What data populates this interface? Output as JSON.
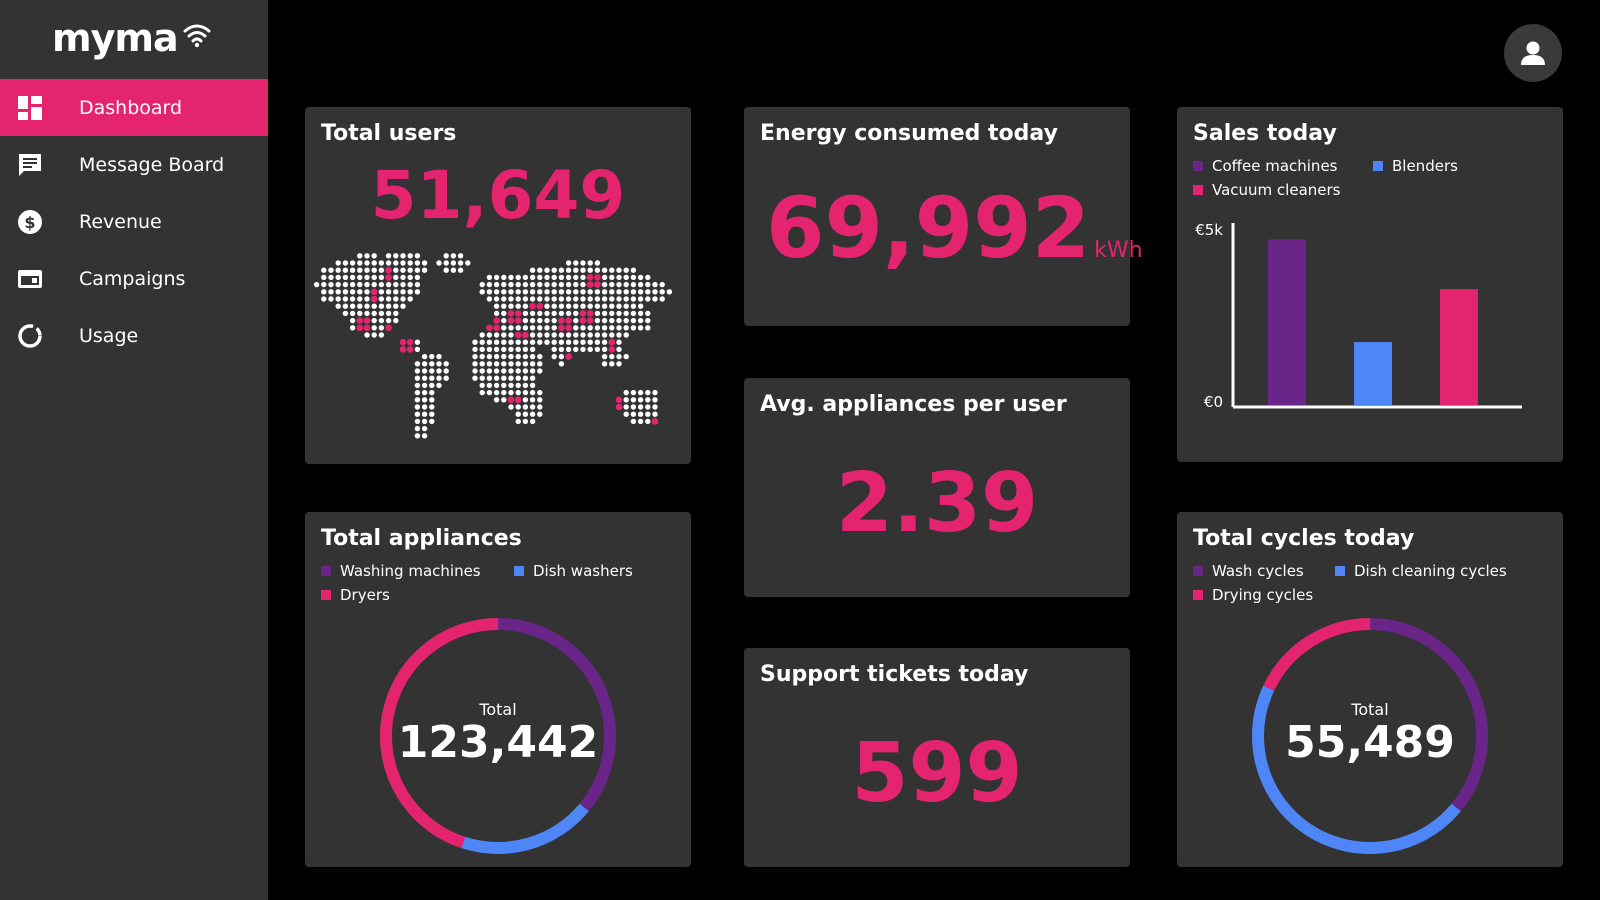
{
  "app": {
    "logo_text": "myma"
  },
  "sidebar": {
    "items": [
      {
        "label": "Dashboard",
        "icon": "dashboard-grid-icon",
        "active": true
      },
      {
        "label": "Message Board",
        "icon": "message-icon"
      },
      {
        "label": "Revenue",
        "icon": "dollar-icon"
      },
      {
        "label": "Campaigns",
        "icon": "campaign-icon"
      },
      {
        "label": "Usage",
        "icon": "usage-ring-icon"
      }
    ]
  },
  "header": {
    "avatar_icon": "user-icon"
  },
  "colors": {
    "accent": "#e5246f",
    "purple": "#6a2588",
    "blue": "#4f86f7",
    "card": "#333333",
    "background": "#000000"
  },
  "cards": {
    "total_users": {
      "title": "Total users",
      "value": "51,649"
    },
    "energy": {
      "title": "Energy consumed today",
      "value": "69,992",
      "unit": "kWh"
    },
    "avg_appliances": {
      "title": "Avg. appliances per user",
      "value": "2.39"
    },
    "support_tickets": {
      "title": "Support tickets today",
      "value": "599"
    },
    "sales": {
      "title": "Sales today",
      "legend": [
        "Coffee machines",
        "Blenders",
        "Vacuum cleaners"
      ]
    },
    "total_appliances": {
      "title": "Total appliances",
      "legend": [
        "Washing machines",
        "Dish washers",
        "Dryers"
      ],
      "center_label": "Total",
      "center_value": "123,442"
    },
    "total_cycles": {
      "title": "Total cycles today",
      "legend": [
        "Wash cycles",
        "Dish cleaning cycles",
        "Drying cycles"
      ],
      "center_label": "Total",
      "center_value": "55,489"
    }
  },
  "chart_data": [
    {
      "type": "bar",
      "title": "Sales today",
      "categories": [
        "Coffee machines",
        "Blenders",
        "Vacuum cleaners"
      ],
      "values": [
        5000,
        1900,
        3500
      ],
      "ytick_labels": [
        "€0",
        "€5k"
      ],
      "ylim": [
        0,
        5000
      ],
      "colors": [
        "#6a2588",
        "#4f86f7",
        "#e5246f"
      ]
    },
    {
      "type": "pie",
      "title": "Total appliances",
      "categories": [
        "Washing machines",
        "Dish washers",
        "Dryers"
      ],
      "values": [
        0.36,
        0.19,
        0.45
      ],
      "colors": [
        "#6a2588",
        "#4f86f7",
        "#e5246f"
      ]
    },
    {
      "type": "pie",
      "title": "Total cycles today",
      "categories": [
        "Wash cycles",
        "Dish cleaning cycles",
        "Drying cycles"
      ],
      "values": [
        0.36,
        0.46,
        0.18
      ],
      "colors": [
        "#6a2588",
        "#4f86f7",
        "#e5246f"
      ]
    }
  ]
}
